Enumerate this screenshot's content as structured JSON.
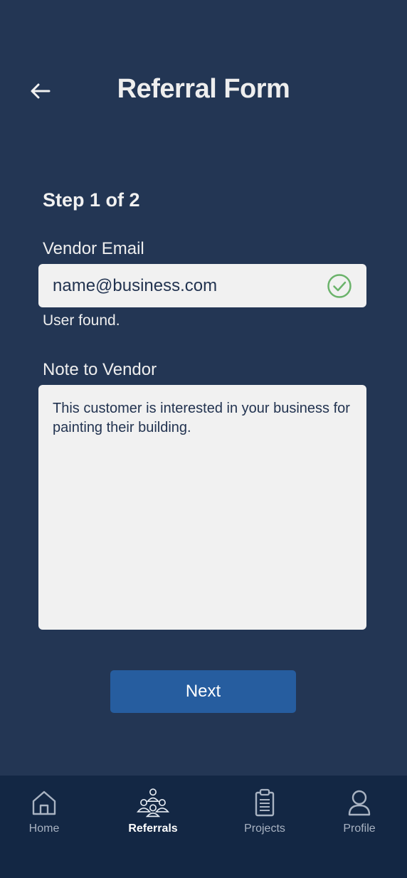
{
  "header": {
    "title": "Referral Form",
    "back_icon": "arrow-left-icon"
  },
  "form": {
    "step_label": "Step 1 of 2",
    "email": {
      "label": "Vendor Email",
      "value": "name@business.com",
      "status_icon": "check-circle-icon",
      "helper": "User found."
    },
    "note": {
      "label": "Note to Vendor",
      "value": "This customer is interested in your business for painting their building."
    },
    "next_label": "Next"
  },
  "nav": {
    "items": [
      {
        "label": "Home",
        "icon": "home-icon",
        "active": false
      },
      {
        "label": "Referrals",
        "icon": "group-icon",
        "active": true
      },
      {
        "label": "Projects",
        "icon": "clipboard-icon",
        "active": false
      },
      {
        "label": "Profile",
        "icon": "person-icon",
        "active": false
      }
    ]
  },
  "colors": {
    "background": "#233654",
    "nav_background": "#132744",
    "button": "#265d9f",
    "field": "#f1f1f1",
    "success": "#6bb36b",
    "field_text": "#223350"
  }
}
